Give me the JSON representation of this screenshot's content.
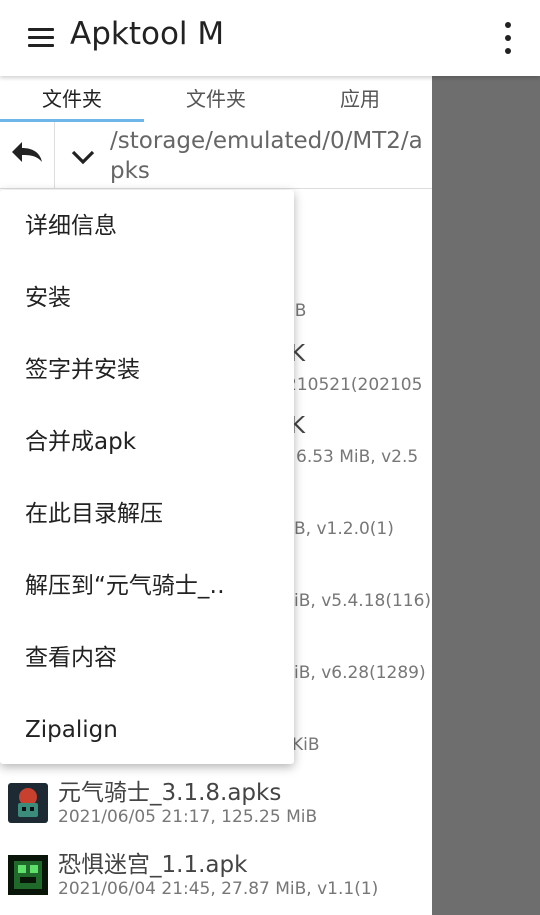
{
  "appbar": {
    "title": "Apktool M"
  },
  "tabs": [
    {
      "label": "文件夹"
    },
    {
      "label": "文件夹"
    },
    {
      "label": "应用"
    }
  ],
  "path": {
    "text": "/storage/emulated/0/MT2/apks"
  },
  "files_partial": [
    {
      "name": "",
      "meta": "iB"
    },
    {
      "name": "K",
      "meta": "210521(202105"
    },
    {
      "name": "K",
      "meta": "6.53 MiB, v2.5"
    },
    {
      "name": "",
      "meta": "B, v1.2.0(1)"
    },
    {
      "name": "",
      "meta": "iB, v5.4.18(116)"
    },
    {
      "name": "",
      "meta": "iB, v6.28(1289)"
    },
    {
      "name": "",
      "meta": "KiB"
    }
  ],
  "files": [
    {
      "name": "元气骑士_3.1.8.apks",
      "meta": "2021/06/05 21:17, 125.25 MiB"
    },
    {
      "name": "恐惧迷宫_1.1.apk",
      "meta": "2021/06/04 21:45, 27.87 MiB, v1.1(1)"
    }
  ],
  "popup": {
    "items": [
      {
        "label": "详细信息"
      },
      {
        "label": "安装"
      },
      {
        "label": "签字并安装"
      },
      {
        "label": "合并成apk"
      },
      {
        "label": "在此目录解压"
      },
      {
        "label": "解压到“元气骑士_‥"
      },
      {
        "label": "查看内容"
      },
      {
        "label": "Zipalign"
      }
    ]
  },
  "colors": {
    "tab_indicator": "#6fb6e8",
    "scrim": "#6e6e6e"
  }
}
